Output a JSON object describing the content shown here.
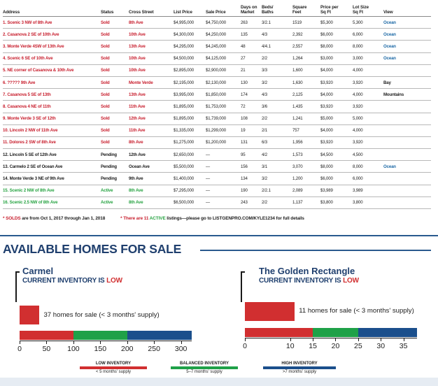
{
  "table": {
    "headers": {
      "address": "Address",
      "status": "Status",
      "cross": "Cross Street",
      "list": "List Price",
      "sale": "Sale Price",
      "dom": [
        "Days on",
        "Market"
      ],
      "bb": [
        "Beds/",
        "Baths"
      ],
      "sqft": [
        "Square",
        "Feet"
      ],
      "ppsf": [
        "Price per",
        "Sq Ft"
      ],
      "lot": [
        "Lot Size",
        "Sq Ft"
      ],
      "view": "View"
    },
    "rows": [
      {
        "address": "1. Scenic 3 NW of 8th Ave",
        "status": "Sold",
        "cross": "8th Ave",
        "list": "$4,995,000",
        "sale": "$4,750,000",
        "dom": "263",
        "bb": "3/2.1",
        "sqft": "1519",
        "ppsf": "$5,300",
        "lot": "5,300",
        "view": "Ocean"
      },
      {
        "address": "2. Casanova 2 SE of 10th Ave",
        "status": "Sold",
        "cross": "10th Ave",
        "list": "$4,300,000",
        "sale": "$4,250,000",
        "dom": "135",
        "bb": "4/3",
        "sqft": "2,392",
        "ppsf": "$6,000",
        "lot": "6,000",
        "view": "Ocean"
      },
      {
        "address": "3. Monte Verde 4SW of 13th Ave",
        "status": "Sold",
        "cross": "13th Ave",
        "list": "$4,295,000",
        "sale": "$4,245,000",
        "dom": "48",
        "bb": "4/4.1",
        "sqft": "2,557",
        "ppsf": "$8,000",
        "lot": "8,000",
        "view": "Ocean"
      },
      {
        "address": "4. Scenic 6 SE of 10th Ave",
        "status": "Sold",
        "cross": "10th Ave",
        "list": "$4,500,000",
        "sale": "$4,125,000",
        "dom": "27",
        "bb": "2/2",
        "sqft": "1,264",
        "ppsf": "$3,000",
        "lot": "3,000",
        "view": "Ocean"
      },
      {
        "address": "5. NE corner of Casanova & 10th Ave",
        "status": "Sold",
        "cross": "10th Ave",
        "list": "$2,895,000",
        "sale": "$2,900,000",
        "dom": "21",
        "bb": "3/3",
        "sqft": "1,600",
        "ppsf": "$4,000",
        "lot": "4,000",
        "view": ""
      },
      {
        "address": "6. ????? 9th Ave",
        "status": "Sold",
        "cross": "Monte Verde",
        "list": "$2,195,000",
        "sale": "$2,130,000",
        "dom": "130",
        "bb": "3/2",
        "sqft": "1,630",
        "ppsf": "$3,920",
        "lot": "3,920",
        "view": "Bay"
      },
      {
        "address": "7. Casanova 5 SE of 13th",
        "status": "Sold",
        "cross": "13th Ave",
        "list": "$3,995,000",
        "sale": "$1,850,000",
        "dom": "174",
        "bb": "4/3",
        "sqft": "2,125",
        "ppsf": "$4,000",
        "lot": "4,000",
        "view": "Mountains"
      },
      {
        "address": "8. Casanova 4 NE of 11th",
        "status": "Sold",
        "cross": "11th Ave",
        "list": "$1,895,000",
        "sale": "$1,753,000",
        "dom": "72",
        "bb": "3/6",
        "sqft": "1,435",
        "ppsf": "$3,920",
        "lot": "3,920",
        "view": ""
      },
      {
        "address": "9. Monte Verde 3 SE of 12th",
        "status": "Sold",
        "cross": "12th Ave",
        "list": "$1,895,000",
        "sale": "$1,739,000",
        "dom": "108",
        "bb": "2/2",
        "sqft": "1,241",
        "ppsf": "$5,000",
        "lot": "5,000",
        "view": ""
      },
      {
        "address": "10. Lincoln 2 NW of 11th Ave",
        "status": "Sold",
        "cross": "11th Ave",
        "list": "$1,335,000",
        "sale": "$1,299,000",
        "dom": "19",
        "bb": "2/1",
        "sqft": "757",
        "ppsf": "$4,000",
        "lot": "4,000",
        "view": ""
      },
      {
        "address": "11. Dolores 2 SW of 8th Ave",
        "status": "Sold",
        "cross": "8th Ave",
        "list": "$1,275,000",
        "sale": "$1,200,000",
        "dom": "131",
        "bb": "6/3",
        "sqft": "1,956",
        "ppsf": "$3,920",
        "lot": "3,920",
        "view": ""
      },
      {
        "address": "12. Lincoln 5 SE of 12th Ave",
        "status": "Pending",
        "cross": "12th Ave",
        "list": "$2,650,000",
        "sale": "—",
        "dom": "95",
        "bb": "4/2",
        "sqft": "1,573",
        "ppsf": "$4,500",
        "lot": "4,500",
        "view": ""
      },
      {
        "address": "13. Carmelo 2 SE of Ocean Ave",
        "status": "Pending",
        "cross": "Ocean Ave",
        "list": "$5,500,000",
        "sale": "—",
        "dom": "156",
        "bb": "3/1",
        "sqft": "3,070",
        "ppsf": "$8,000",
        "lot": "8,000",
        "view": "Ocean"
      },
      {
        "address": "14. Monte Verde 3 NE of 9th Ave",
        "status": "Pending",
        "cross": "9th Ave",
        "list": "$1,400,000",
        "sale": "—",
        "dom": "134",
        "bb": "3/2",
        "sqft": "1,200",
        "ppsf": "$6,000",
        "lot": "6,000",
        "view": ""
      },
      {
        "address": "15. Scenic 2 NW of 8th Ave",
        "status": "Active",
        "cross": "8th Ave",
        "list": "$7,295,000",
        "sale": "—",
        "dom": "190",
        "bb": "2/2.1",
        "sqft": "2,089",
        "ppsf": "$3,989",
        "lot": "3,989",
        "view": ""
      },
      {
        "address": "16. Scenic 2.5 NW of 8th Ave",
        "status": "Active",
        "cross": "8th Ave",
        "list": "$6,500,000",
        "sale": "—",
        "dom": "243",
        "bb": "2/2",
        "sqft": "1,137",
        "ppsf": "$3,800",
        "lot": "3,800",
        "view": ""
      }
    ]
  },
  "notes": {
    "n1_star": "* SOLDS",
    "n1_rest": " are from Oct 1, 2017 through Jan 1, 2018",
    "n2_star": "* There are 11 ",
    "n2_active": "ACTIVE",
    "n2_rest": " listings—please go to LISTGENPRO.COM/KYLE1234 for full details"
  },
  "available": {
    "title": "AVAILABLE HOMES FOR SALE",
    "inventory_prefix": "CURRENT INVENTORY IS ",
    "inventory_low": "LOW",
    "panels": [
      {
        "name": "Carmel",
        "homes_text": "37 homes for sale  (< 3 months' supply)",
        "homes_value": 37,
        "scale_max": 320,
        "low_end": 100,
        "bal_end": 200,
        "high_end": 320,
        "ticks": [
          "0",
          "50",
          "100",
          "150",
          "200",
          "250",
          "300"
        ],
        "tick_values": [
          0,
          50,
          100,
          150,
          200,
          250,
          300
        ]
      },
      {
        "name": "The Golden Rectangle",
        "homes_text": "11 homes for sale  (< 3 months' supply)",
        "homes_value": 11,
        "scale_max": 38,
        "low_end": 15,
        "bal_end": 25,
        "high_end": 38,
        "ticks": [
          "0",
          "10",
          "15",
          "20",
          "25",
          "30",
          "35"
        ],
        "tick_values": [
          0,
          10,
          15,
          20,
          25,
          30,
          35
        ]
      }
    ],
    "legend": [
      {
        "title": "LOW INVENTORY",
        "sub": "< 5 months' supply",
        "color": "#d12f30"
      },
      {
        "title": "BALANCED INVENTORY",
        "sub": "5–7 months' supply",
        "color": "#1fa148"
      },
      {
        "title": "HIGH INVENTORY",
        "sub": ">7 months' supply",
        "color": "#1b4f8c"
      }
    ]
  },
  "colors": {
    "sold": "#c8202f",
    "active": "#27a342",
    "navy": "#1f3f6e",
    "ocean": "#1e6aa6"
  }
}
